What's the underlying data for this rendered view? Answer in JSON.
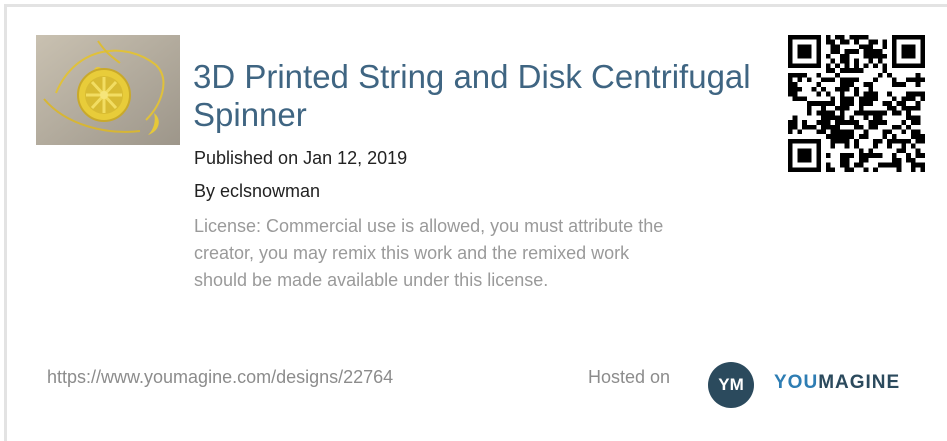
{
  "design": {
    "title": "3D Printed String and Disk Centrifugal Spinner",
    "published": "Published on Jan 12, 2019",
    "author": "By eclsnowman",
    "license": "License: Commercial use is allowed, you must attribute the creator, you may remix this work and the remixed work should be made available under this license.",
    "url": "https://www.youmagine.com/designs/22764",
    "thumbnail_icon": "yellow-spinner-disk-photo",
    "qr_icon": "qr-code"
  },
  "footer": {
    "hosted_label": "Hosted on",
    "logo_badge": "YM",
    "logo_word_part1": "YOU",
    "logo_word_part2": "MAGINE"
  },
  "colors": {
    "title": "#3f6582",
    "license_text": "#9a9a9a",
    "logo_dark": "#2b4a5d",
    "logo_blue": "#2e7db3"
  }
}
